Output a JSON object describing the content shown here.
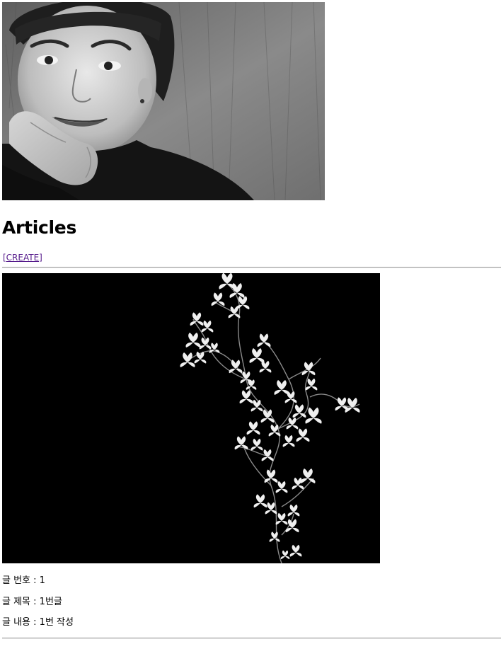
{
  "page": {
    "heading": "Articles",
    "create_link": "[CREATE]"
  },
  "article": {
    "number_label": "글 번호 : ",
    "number_value": "1",
    "title_label": "글 제목 : ",
    "title_value": "1번글",
    "content_label": "글 내용 : ",
    "content_value": "1번 작성"
  },
  "colors": {
    "link_visited": "#551a8b",
    "rule": "#9a9a9a",
    "image_background": "#000000"
  }
}
